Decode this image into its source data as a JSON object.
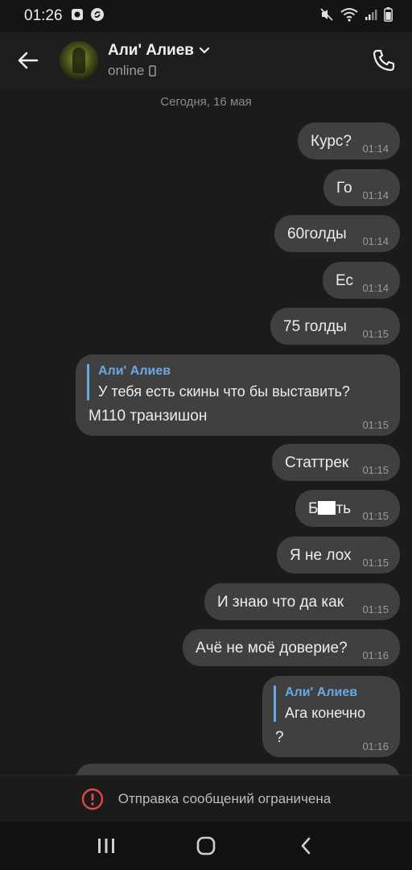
{
  "status_bar": {
    "time": "01:26",
    "icons": [
      "app-notification-icon",
      "shazam-icon",
      "mute-icon",
      "wifi-icon",
      "signal-icon",
      "battery-icon"
    ]
  },
  "header": {
    "contact_name": "Али' Алиев",
    "contact_status": "online",
    "icons": [
      "back-arrow-icon",
      "chevron-down-icon",
      "mobile-device-icon",
      "phone-call-icon"
    ]
  },
  "chat": {
    "date_separator": "Сегодня, 16 мая",
    "messages": [
      {
        "text": "Курс?",
        "time": "01:14"
      },
      {
        "text": "Го",
        "time": "01:14"
      },
      {
        "text": "60голды",
        "time": "01:14"
      },
      {
        "text": "Ес",
        "time": "01:14"
      },
      {
        "text": "75 голды",
        "time": "01:15"
      },
      {
        "reply_name": "Али' Алиев",
        "reply_text": "У тебя есть скины что бы выставить?",
        "text": "M110 транзишон",
        "time": "01:15"
      },
      {
        "text": "Статтрек",
        "time": "01:15"
      },
      {
        "text_start": "Б",
        "text_end": "ть",
        "time": "01:15"
      },
      {
        "text": "Я не лох",
        "time": "01:15"
      },
      {
        "text": "И знаю что да как",
        "time": "01:15"
      },
      {
        "text": "Ачё не моё доверие?",
        "time": "01:16"
      },
      {
        "reply_name": "Али' Алиев",
        "reply_text": "Ага конечно",
        "text": "?",
        "time": "01:16"
      }
    ]
  },
  "restriction": {
    "text": "Отправка сообщений ограничена",
    "icon": "alert-circle-icon",
    "accent": "#e0474c"
  },
  "navbar": {
    "icons": [
      "recents-icon",
      "home-icon",
      "back-icon"
    ]
  },
  "colors": {
    "background": "#1b1b1b",
    "bubble": "#404040",
    "reply_accent": "#6aa9e6"
  }
}
